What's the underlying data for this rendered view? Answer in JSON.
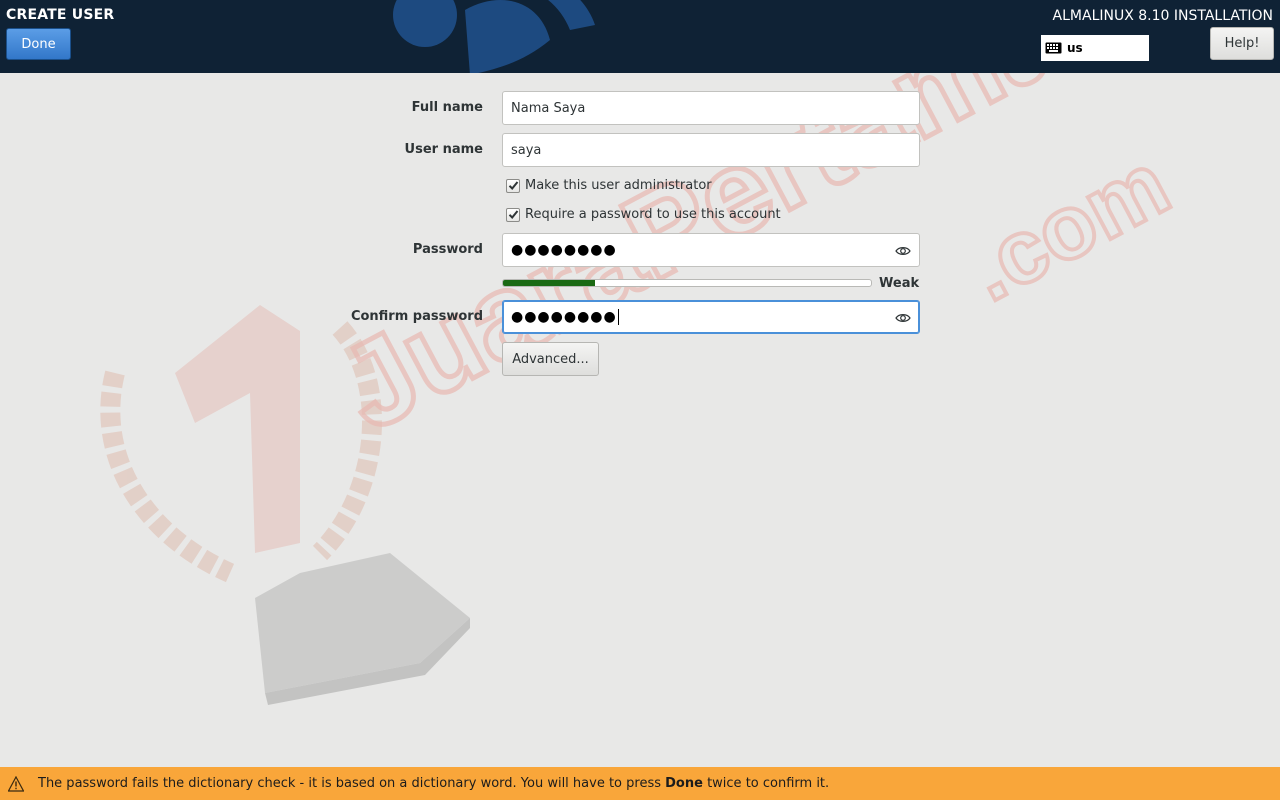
{
  "header": {
    "spoke_title": "CREATE USER",
    "done_label": "Done",
    "product_title": "ALMALINUX 8.10 INSTALLATION",
    "keyboard_layout": "us",
    "help_label": "Help!"
  },
  "form": {
    "full_name_label": "Full name",
    "full_name_value": "Nama Saya",
    "user_name_label": "User name",
    "user_name_value": "saya",
    "admin_checkbox_label": "Make this user administrator",
    "admin_checked": true,
    "require_password_label": "Require a password to use this account",
    "require_password_checked": true,
    "password_label": "Password",
    "password_masked": "●●●●●●●●",
    "strength_label": "Weak",
    "strength_level": 0.25,
    "confirm_label": "Confirm password",
    "confirm_masked": "●●●●●●●●",
    "advanced_label": "Advanced..."
  },
  "warning": {
    "text_before": "The password fails the dictionary check - it is based on a dictionary word. You will have to press ",
    "emphasis": "Done",
    "text_after": " twice to confirm it."
  },
  "watermark": {
    "text": "JuaraPertama",
    "suffix": ".com",
    "numeral": "1"
  },
  "colors": {
    "header_bg": "#0f2235",
    "accent": "#4a90d9",
    "warning_bg": "#f9a63a",
    "strength_fill": "#1b6a14"
  }
}
